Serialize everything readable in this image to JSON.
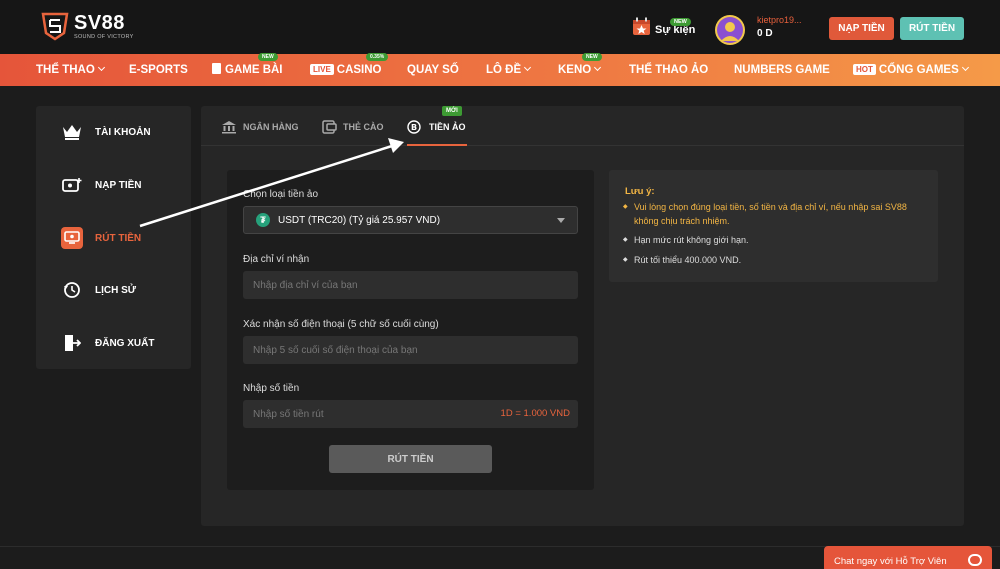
{
  "brand": {
    "name": "SV88",
    "tagline": "SOUND OF VICTORY"
  },
  "header": {
    "event_label": "Sự kiện",
    "event_badge": "NEW",
    "username": "kietpro19...",
    "balance": "0 D",
    "deposit_btn": "NẠP TIỀN",
    "withdraw_btn": "RÚT TIỀN"
  },
  "nav": [
    {
      "label": "THỂ THAO",
      "chevron": true
    },
    {
      "label": "E-SPORTS"
    },
    {
      "label": "GAME BÀI",
      "badge": "NEW"
    },
    {
      "label": "CASINO",
      "tag": "LIVE",
      "badge": "0.35%"
    },
    {
      "label": "QUAY SỐ"
    },
    {
      "label": "LÔ ĐỀ",
      "chevron": true
    },
    {
      "label": "KENO",
      "chevron": true,
      "badge": "NEW"
    },
    {
      "label": "THỂ THAO ẢO"
    },
    {
      "label": "NUMBERS GAME"
    },
    {
      "label": "CỔNG GAMES",
      "tag": "HOT",
      "chevron": true
    }
  ],
  "sidebar": {
    "items": [
      {
        "label": "TÀI KHOẢN",
        "icon": "crown-icon"
      },
      {
        "label": "NẠP TIỀN",
        "icon": "deposit-icon"
      },
      {
        "label": "RÚT TIỀN",
        "icon": "withdraw-icon",
        "active": true
      },
      {
        "label": "LỊCH SỬ",
        "icon": "history-icon"
      },
      {
        "label": "ĐĂNG XUẤT",
        "icon": "logout-icon"
      }
    ]
  },
  "tabs": {
    "items": [
      {
        "label": "NGÂN HÀNG",
        "icon": "bank-icon"
      },
      {
        "label": "THẺ CÀO",
        "icon": "card-icon"
      },
      {
        "label": "TIỀN ẢO",
        "icon": "bitcoin-icon",
        "active": true
      }
    ],
    "new_badge": "MỚI"
  },
  "form": {
    "currency_label": "Chọn loại tiền ảo",
    "currency_symbol": "₮",
    "currency_value": "USDT (TRC20) (Tỷ giá 25.957 VND)",
    "wallet_label": "Địa chỉ ví nhận",
    "wallet_placeholder": "Nhập địa chỉ ví của bạn",
    "phone_label": "Xác nhận số điện thoại (5 chữ số cuối cùng)",
    "phone_placeholder": "Nhập 5 số cuối số điện thoại của bạn",
    "amount_label": "Nhập số tiền",
    "amount_placeholder": "Nhập số tiền rút",
    "rate_hint": "1D = 1.000 VND",
    "submit": "RÚT TIỀN"
  },
  "notice": {
    "title": "Lưu ý:",
    "items": [
      "Vui lòng chọn đúng loại tiền, số tiền và địa chỉ ví, nếu nhập sai SV88 không chịu trách nhiệm.",
      "Hạn mức rút không giới hạn.",
      "Rút tối thiểu 400.000 VND."
    ]
  },
  "chat": {
    "label": "Chat ngay với Hỗ Trợ Viên"
  },
  "colors": {
    "accent": "#e8643d",
    "teal": "#5ec1b3",
    "warn": "#f2b544"
  }
}
